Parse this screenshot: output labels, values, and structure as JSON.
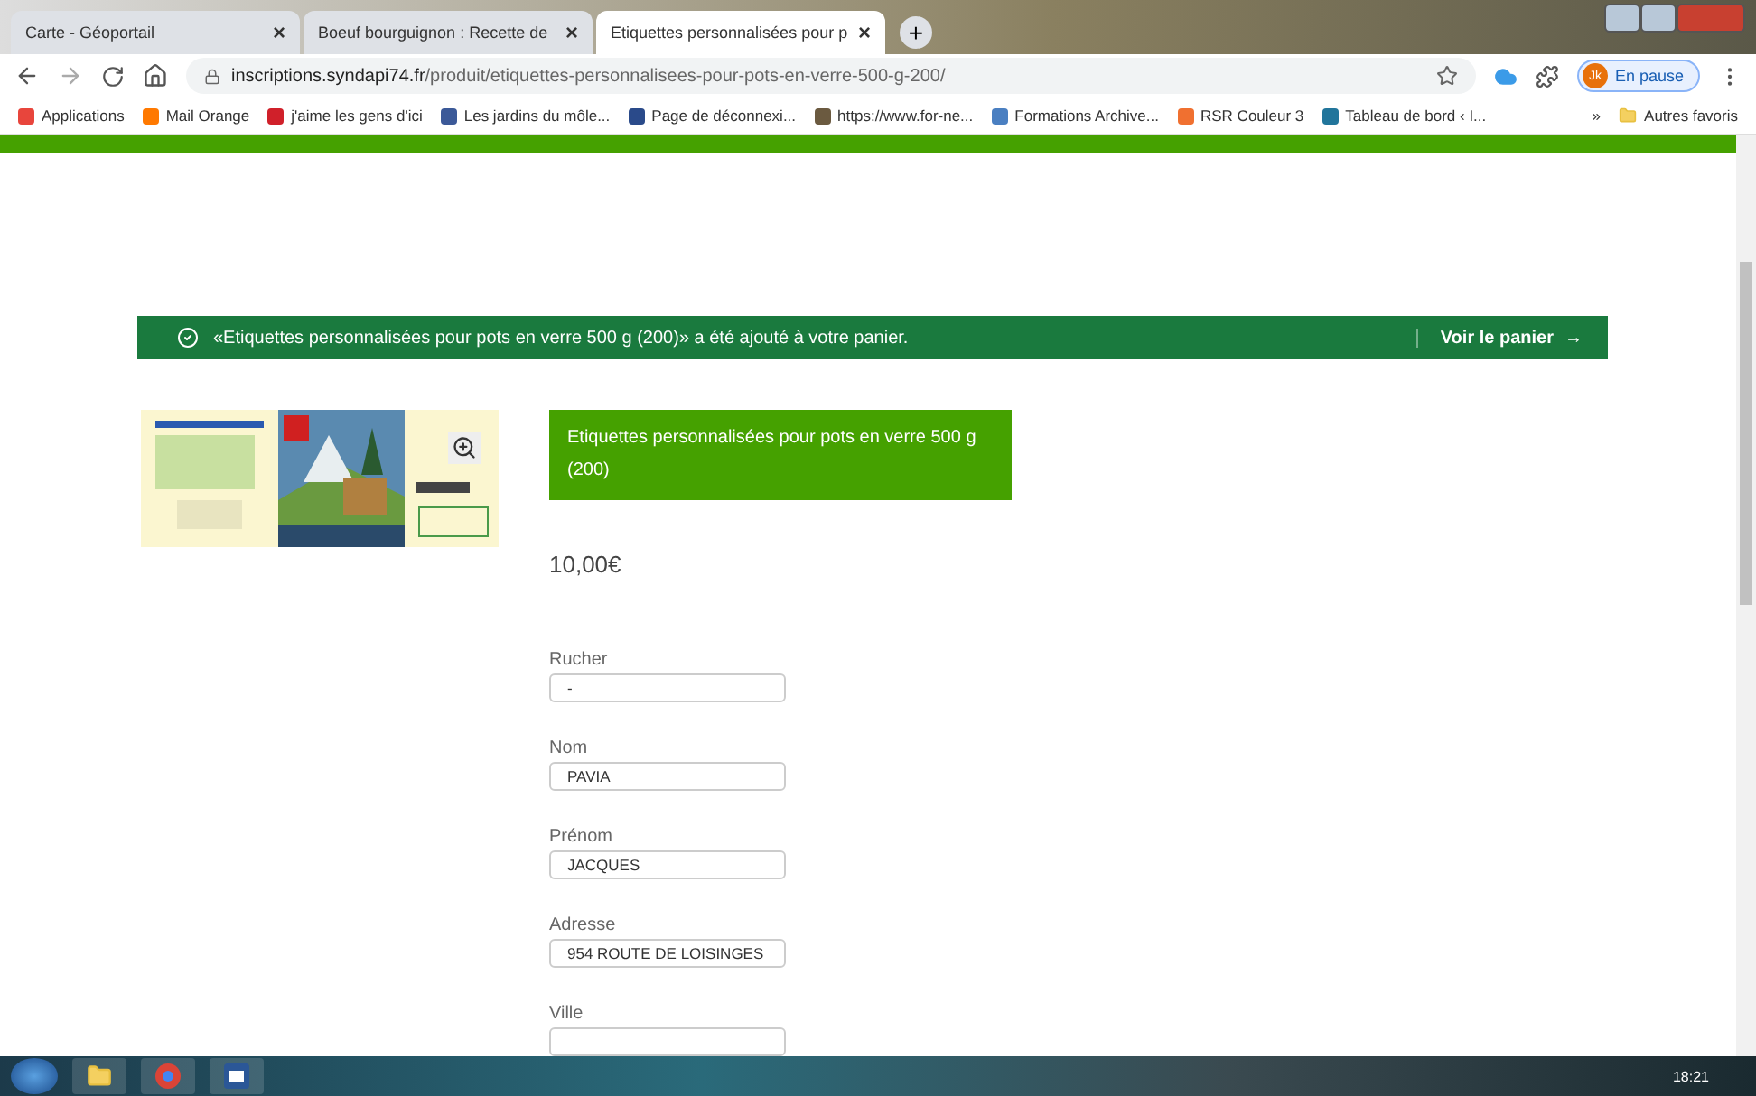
{
  "tabs": [
    {
      "title": "Carte - Géoportail",
      "selected": false,
      "close": "×"
    },
    {
      "title": "Boeuf bourguignon : Recette de",
      "selected": false,
      "close": "×"
    },
    {
      "title": "Etiquettes personnalisées pour p",
      "selected": true,
      "close": "×"
    }
  ],
  "new_tab": "+",
  "address_bar": {
    "host": "inscriptions.syndapi74.fr",
    "path": "/produit/etiquettes-personnalisees-pour-pots-en-verre-500-g-200/"
  },
  "profile": {
    "initials": "Jk",
    "label": "En pause"
  },
  "bookmarks": [
    {
      "label": "Applications",
      "color": "#e8453c"
    },
    {
      "label": "Mail Orange",
      "color": "#ff7900"
    },
    {
      "label": "j'aime les gens d'ici",
      "color": "#d0202a"
    },
    {
      "label": "Les jardins du môle...",
      "color": "#3b5998"
    },
    {
      "label": "Page de déconnexi...",
      "color": "#2a4a8a"
    },
    {
      "label": "https://www.for-ne...",
      "color": "#6b5a40"
    },
    {
      "label": "Formations Archive...",
      "color": "#4a7fc1"
    },
    {
      "label": "RSR Couleur 3",
      "color": "#f07030"
    },
    {
      "label": "Tableau de bord ‹ I...",
      "color": "#21759b"
    }
  ],
  "bookmarks_more": "»",
  "other_bookmarks": "Autres favoris",
  "notice": {
    "message": "«Etiquettes personnalisées pour pots en verre 500 g (200)» a été ajouté à votre panier.",
    "action": "Voir le panier",
    "arrow": "→"
  },
  "product": {
    "title": "Etiquettes personnalisées pour pots en verre 500 g (200)",
    "price": "10,00€",
    "fields": [
      {
        "label": "Rucher",
        "value": "-"
      },
      {
        "label": "Nom",
        "value": "PAVIA"
      },
      {
        "label": "Prénom",
        "value": "JACQUES"
      },
      {
        "label": "Adresse",
        "value": "954 ROUTE DE LOISINGES"
      },
      {
        "label": "Ville"
      }
    ]
  },
  "taskbar": {
    "time": "18:21"
  }
}
